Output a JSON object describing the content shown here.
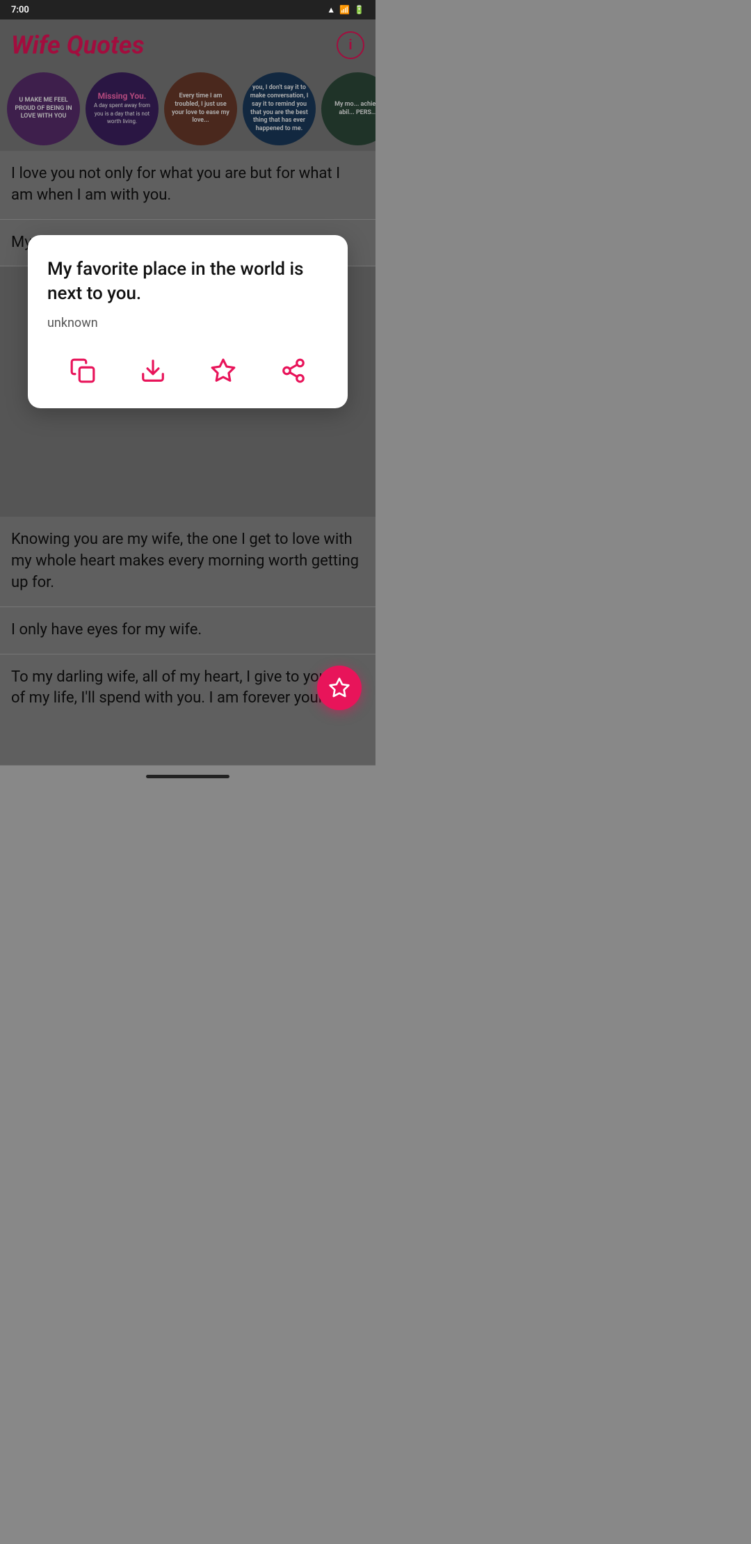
{
  "statusBar": {
    "time": "7:00",
    "icons": [
      "wifi",
      "signal",
      "battery"
    ]
  },
  "header": {
    "title": "Wife Quotes",
    "infoLabel": "i"
  },
  "circles": [
    {
      "id": 1,
      "colorClass": "circle-1",
      "text": "U MAKE ME FEEL PROUD OF BEING IN LOVE WITH YOU"
    },
    {
      "id": 2,
      "colorClass": "circle-2",
      "text": "Missing You.",
      "subtext": "A day spent away from you is a day that is not worth living."
    },
    {
      "id": 3,
      "colorClass": "circle-3",
      "text": "Every time I am troubled, I just use your love to ease my love..."
    },
    {
      "id": 4,
      "colorClass": "circle-4",
      "text": "you, I don't say it to make conversation, I say it to remind you that you are the best thing that has ever happened to me."
    },
    {
      "id": 5,
      "colorClass": "circle-5",
      "text": "My mo... achie... abil... PERS..."
    }
  ],
  "quotes": [
    {
      "id": 1,
      "text": "I love you not only for what you are but for what I am when I am with you."
    },
    {
      "id": 2,
      "text": "My favorite place in the world is next to you."
    },
    {
      "id": 3,
      "text": "Knowing you are my wife, the one I get to love with my whole heart makes every morning worth getting up for."
    },
    {
      "id": 4,
      "text": "I only have eyes for my wife."
    },
    {
      "id": 5,
      "text": "To my darling wife, all of my heart, I give to you. All of my life, I'll spend with you. I am forever yours."
    }
  ],
  "modal": {
    "quoteText": "My favorite place in the world is next to you.",
    "author": "unknown",
    "actions": [
      {
        "id": "copy",
        "name": "copy-icon",
        "label": "Copy"
      },
      {
        "id": "download",
        "name": "download-icon",
        "label": "Download"
      },
      {
        "id": "favorite",
        "name": "favorite-icon",
        "label": "Favorite"
      },
      {
        "id": "share",
        "name": "share-icon",
        "label": "Share"
      }
    ]
  },
  "fab": {
    "label": "Favorites"
  },
  "colors": {
    "accent": "#e8145a",
    "modalBg": "#ffffff",
    "bgDimmed": "#888888"
  }
}
